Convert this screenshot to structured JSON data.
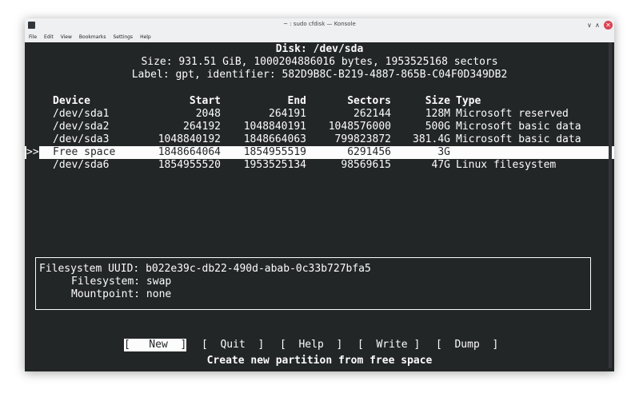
{
  "window": {
    "title": "~ : sudo cfdisk — Konsole",
    "menu": [
      "File",
      "Edit",
      "View",
      "Bookmarks",
      "Settings",
      "Help"
    ]
  },
  "disk": {
    "header": "Disk: /dev/sda",
    "size_line": "Size: 931.51 GiB, 1000204886016 bytes, 1953525168 sectors",
    "label_line": "Label: gpt, identifier: 582D9B8C-B219-4887-865B-C04F0D349DB2"
  },
  "table": {
    "columns": [
      "Device",
      "Start",
      "End",
      "Sectors",
      "Size",
      "Type"
    ],
    "rows": [
      {
        "device": "/dev/sda1",
        "start": "2048",
        "end": "264191",
        "sectors": "262144",
        "size": "128M",
        "type": "Microsoft reserved"
      },
      {
        "device": "/dev/sda2",
        "start": "264192",
        "end": "1048840191",
        "sectors": "1048576000",
        "size": "500G",
        "type": "Microsoft basic data"
      },
      {
        "device": "/dev/sda3",
        "start": "1048840192",
        "end": "1848664063",
        "sectors": "799823872",
        "size": "381.4G",
        "type": "Microsoft basic data"
      },
      {
        "device": "Free space",
        "start": "1848664064",
        "end": "1854955519",
        "sectors": "6291456",
        "size": "3G",
        "type": ""
      },
      {
        "device": "/dev/sda6",
        "start": "1854955520",
        "end": "1953525134",
        "sectors": "98569615",
        "size": "47G",
        "type": "Linux filesystem"
      }
    ],
    "selected_marker": ">>"
  },
  "info": {
    "uuid_label": "Filesystem UUID:",
    "uuid_value": "b022e39c-db22-490d-abab-0c33b727bfa5",
    "fs_label": "Filesystem:",
    "fs_value": "swap",
    "mp_label": "Mountpoint:",
    "mp_value": "none"
  },
  "menu": {
    "new": "[   New  ]",
    "quit": "[  Quit  ]",
    "help": "[  Help  ]",
    "write": "[  Write ]",
    "dump": "[  Dump  ]"
  },
  "status": "Create new partition from free space",
  "colors": {
    "background": "#232627",
    "foreground": "#fcfcfc",
    "close": "#da4453"
  }
}
